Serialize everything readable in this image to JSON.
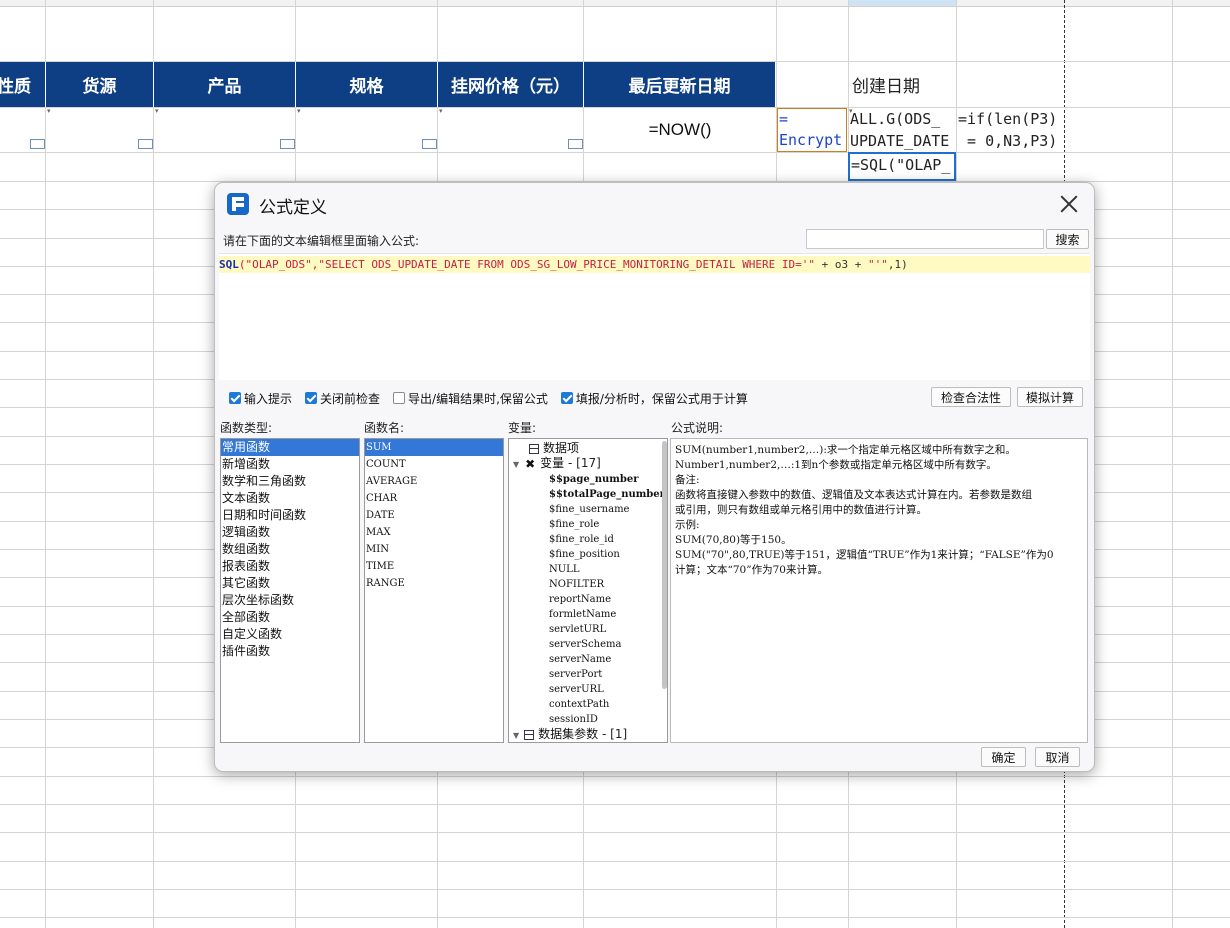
{
  "sheet": {
    "headers": [
      "性质",
      "货源",
      "产品",
      "规格",
      "挂网价格（元）",
      "最后更新日期"
    ],
    "plain_header": "创建日期",
    "formulas": {
      "now": "=NOW()",
      "encrypt": "=\nEncrypt",
      "all_g": "ALL.G(ODS_\nUPDATE_DATE",
      "if_len": "=if(len(P3)\n = 0,N3,P3)",
      "sql": "=SQL(\"OLAP_"
    }
  },
  "dialog": {
    "title": "公式定义",
    "prompt": "请在下面的文本编辑框里面输入公式:",
    "search_placeholder": "",
    "search_button": "搜索",
    "formula_parts": {
      "fn": "SQL",
      "p1": "(\"OLAP_ODS\",\"SELECT ODS_UPDATE_DATE FROM ODS_SG_LOW_PRICE_MONITORING_DETAIL WHERE ID='\" ",
      "p2": "+ o3 + ",
      "p3": "\"'\"",
      "p4": ",1)"
    },
    "options": {
      "input_hint": "输入提示",
      "check_before_close": "关闭前检查",
      "export_keep": "导出/编辑结果时,保留公式",
      "fill_keep": "填报/分析时，保留公式用于计算"
    },
    "check_validity": "检查合法性",
    "simulate": "模拟计算",
    "labels": {
      "func_type": "函数类型:",
      "func_name": "函数名:",
      "variable": "变量:",
      "description": "公式说明:"
    },
    "func_types": [
      "常用函数",
      "新增函数",
      "数学和三角函数",
      "文本函数",
      "日期和时间函数",
      "逻辑函数",
      "数组函数",
      "报表函数",
      "其它函数",
      "层次坐标函数",
      "全部函数",
      "自定义函数",
      "插件函数"
    ],
    "func_names": [
      "SUM",
      "COUNT",
      "AVERAGE",
      "CHAR",
      "DATE",
      "MAX",
      "MIN",
      "TIME",
      "RANGE"
    ],
    "variables": {
      "data_item": "数据项",
      "var_label": "变量",
      "var_count": "- [17]",
      "items": [
        "$$page_number",
        "$$totalPage_number",
        "$fine_username",
        "$fine_role",
        "$fine_role_id",
        "$fine_position",
        "NULL",
        "NOFILTER",
        "reportName",
        "formletName",
        "servletURL",
        "serverSchema",
        "serverName",
        "serverPort",
        "serverURL",
        "contextPath",
        "sessionID"
      ],
      "dataset_label": "数据集参数",
      "dataset_count": "- [1]"
    },
    "description_lines": [
      "SUM(number1,number2,…):求一个指定单元格区域中所有数字之和。",
      "Number1,number2,…:1到n个参数或指定单元格区域中所有数字。",
      "备注:",
      "函数将直接键入参数中的数值、逻辑值及文本表达式计算在内。若参数是数组",
      "或引用，则只有数组或单元格引用中的数值进行计算。",
      "示例:",
      "SUM(70,80)等于150。",
      "SUM(\"70\",80,TRUE)等于151，逻辑值“TRUE”作为1来计算；“FALSE”作为0",
      "计算；文本“70”作为70来计算。"
    ],
    "ok": "确定",
    "cancel": "取消"
  },
  "colors": {
    "header_blue": "#0e3f84",
    "selection_blue": "#3377d7",
    "highlight_yellow": "#fffac2"
  }
}
